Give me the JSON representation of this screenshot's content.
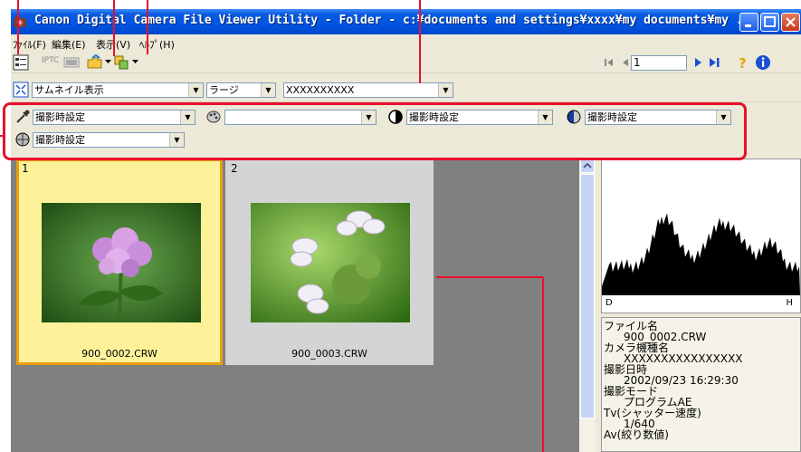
{
  "window": {
    "title": "Canon Digital Camera File Viewer Utility - Folder - c:¥documents and settings¥xxxx¥my documents¥my ..."
  },
  "menu": [
    "ﾌｧｲﾙ(F)",
    "編集(E)",
    "表示(V)",
    "ﾍﾙﾌﾟ(H)"
  ],
  "toolbar": {
    "iptc_label": "IPTC",
    "page_value": "1"
  },
  "view": {
    "mode": "サムネイル表示",
    "size": "ラージ",
    "camera": "XXXXXXXXXX"
  },
  "adjust": {
    "wb": "撮影時設定",
    "picture_style": "",
    "contrast": "撮影時設定",
    "saturation": "撮影時設定",
    "tone": "撮影時設定"
  },
  "thumbnails": [
    {
      "num": "1",
      "file": "900_0002.CRW",
      "selected": true
    },
    {
      "num": "2",
      "file": "900_0003.CRW",
      "selected": false
    }
  ],
  "histogram": {
    "left_label": "D",
    "right_label": "H"
  },
  "info": [
    {
      "label": "ファイル名",
      "value": "900_0002.CRW"
    },
    {
      "label": "カメラ機種名",
      "value": "XXXXXXXXXXXXXXXX"
    },
    {
      "label": "撮影日時",
      "value": "2002/09/23 16:29:30"
    },
    {
      "label": "撮影モード",
      "value": "プログラムAE"
    },
    {
      "label": "Tv(シャッター速度)",
      "value": "1/640"
    },
    {
      "label": "Av(絞り数値)",
      "value": ""
    }
  ],
  "colors": {
    "accent_red": "#e8102a",
    "selected_card": "#fdf29a",
    "title_blue": "#0054e3"
  }
}
